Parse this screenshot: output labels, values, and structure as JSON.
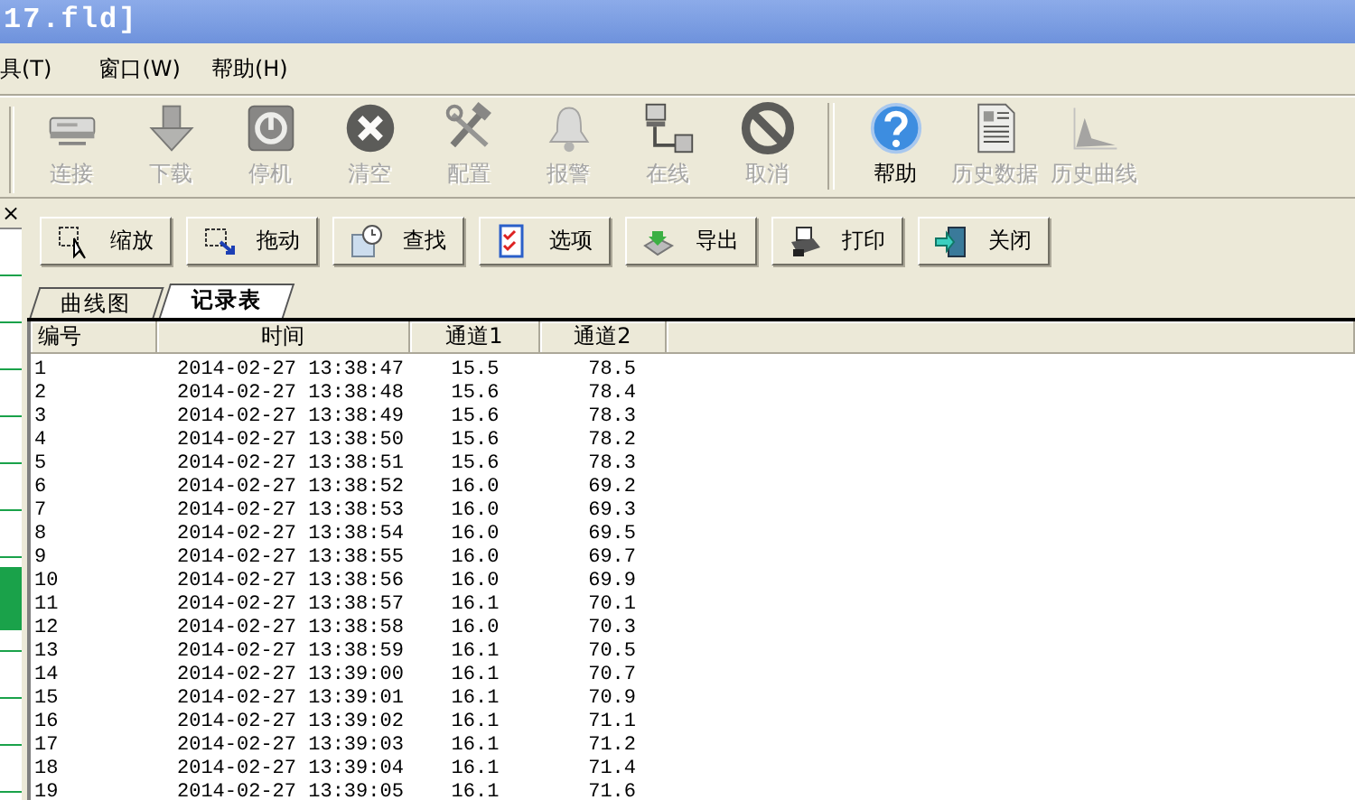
{
  "window": {
    "title": "17.fld]"
  },
  "menu": [
    "具(T)",
    "窗口(W)",
    "帮助(H)"
  ],
  "toolbar": [
    {
      "label": "连接",
      "disabled": true
    },
    {
      "label": "下载",
      "disabled": true
    },
    {
      "label": "停机",
      "disabled": true
    },
    {
      "label": "清空",
      "disabled": true
    },
    {
      "label": "配置",
      "disabled": true
    },
    {
      "label": "报警",
      "disabled": true
    },
    {
      "label": "在线",
      "disabled": true
    },
    {
      "label": "取消",
      "disabled": true
    },
    {
      "label": "帮助",
      "disabled": false
    },
    {
      "label": "历史数据",
      "disabled": true
    },
    {
      "label": "历史曲线",
      "disabled": true
    }
  ],
  "side_panel": {
    "close": "×"
  },
  "actions": [
    "缩放",
    "拖动",
    "查找",
    "选项",
    "导出",
    "打印",
    "关闭"
  ],
  "tabs": [
    {
      "label": "曲线图",
      "selected": false
    },
    {
      "label": "记录表",
      "selected": true
    }
  ],
  "table": {
    "columns": [
      "编号",
      "时间",
      "通道1",
      "通道2"
    ],
    "rows": [
      [
        "1",
        "2014-02-27 13:38:47",
        "15.5",
        "78.5"
      ],
      [
        "2",
        "2014-02-27 13:38:48",
        "15.6",
        "78.4"
      ],
      [
        "3",
        "2014-02-27 13:38:49",
        "15.6",
        "78.3"
      ],
      [
        "4",
        "2014-02-27 13:38:50",
        "15.6",
        "78.2"
      ],
      [
        "5",
        "2014-02-27 13:38:51",
        "15.6",
        "78.3"
      ],
      [
        "6",
        "2014-02-27 13:38:52",
        "16.0",
        "69.2"
      ],
      [
        "7",
        "2014-02-27 13:38:53",
        "16.0",
        "69.3"
      ],
      [
        "8",
        "2014-02-27 13:38:54",
        "16.0",
        "69.5"
      ],
      [
        "9",
        "2014-02-27 13:38:55",
        "16.0",
        "69.7"
      ],
      [
        "10",
        "2014-02-27 13:38:56",
        "16.0",
        "69.9"
      ],
      [
        "11",
        "2014-02-27 13:38:57",
        "16.1",
        "70.1"
      ],
      [
        "12",
        "2014-02-27 13:38:58",
        "16.0",
        "70.3"
      ],
      [
        "13",
        "2014-02-27 13:38:59",
        "16.1",
        "70.5"
      ],
      [
        "14",
        "2014-02-27 13:39:00",
        "16.1",
        "70.7"
      ],
      [
        "15",
        "2014-02-27 13:39:01",
        "16.1",
        "70.9"
      ],
      [
        "16",
        "2014-02-27 13:39:02",
        "16.1",
        "71.1"
      ],
      [
        "17",
        "2014-02-27 13:39:03",
        "16.1",
        "71.2"
      ],
      [
        "18",
        "2014-02-27 13:39:04",
        "16.1",
        "71.4"
      ],
      [
        "19",
        "2014-02-27 13:39:05",
        "16.1",
        "71.6"
      ]
    ]
  }
}
